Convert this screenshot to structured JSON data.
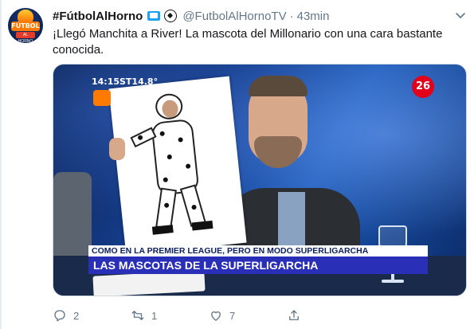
{
  "tweet": {
    "display_name": "#FútbolAlHorno",
    "handle": "@FutbolAlHornoTV",
    "separator": "·",
    "time": "43min",
    "text": "¡Llegó Manchita a River! La mascota del Millonario con una cara bastante conocida."
  },
  "avatar": {
    "brand_top": "FÚTBOL",
    "brand_bottom": "AL HORNO"
  },
  "media": {
    "clock": "14:15",
    "temperature": "ST14.8°",
    "channel": "26",
    "banner_sub": "COMO EN LA PREMIER LEAGUE, PERO EN MODO SUPERLIGARCHA",
    "banner_main": "LAS MASCOTAS DE LA SUPERLIGARCHA"
  },
  "actions": {
    "reply_count": "2",
    "retweet_count": "1",
    "like_count": "7"
  },
  "icons": {
    "reply": "reply-icon",
    "retweet": "retweet-icon",
    "like": "heart-icon",
    "share": "share-icon",
    "more": "chevron-down-icon",
    "tv": "tv-icon",
    "ball": "soccer-ball-icon"
  },
  "colors": {
    "text": "#14171a",
    "muted": "#657786",
    "banner_main": "#2a2fb8",
    "channel_red": "#e2001a"
  }
}
